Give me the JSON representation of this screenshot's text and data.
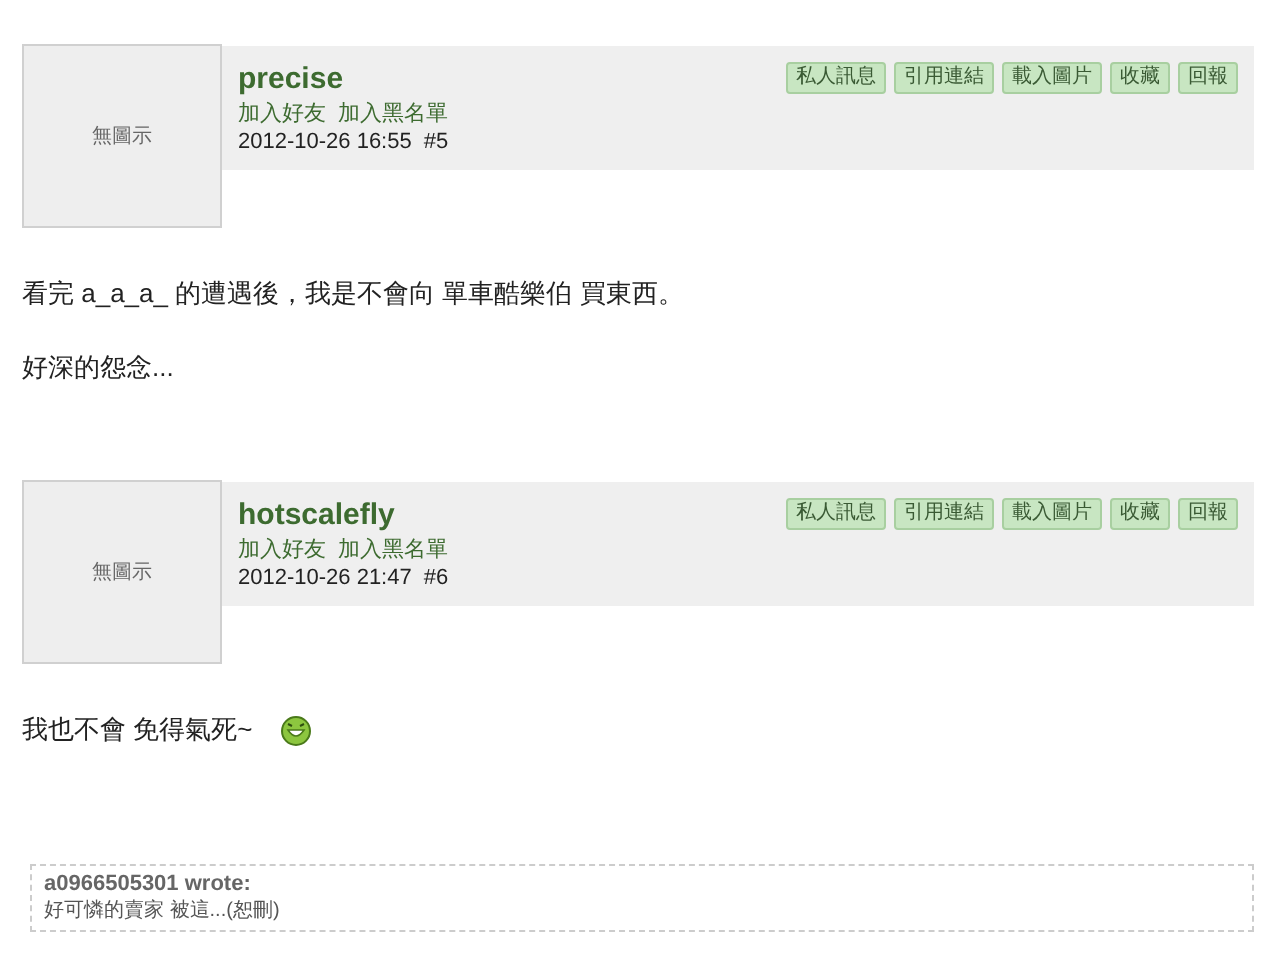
{
  "posts": [
    {
      "avatar": {
        "label": "無圖示"
      },
      "author": "precise",
      "links": [
        "加入好友",
        "加入黑名單"
      ],
      "timestamp": "2012-10-26 16:55",
      "post_number": "#5",
      "actions": [
        "私人訊息",
        "引用連結",
        "載入圖片",
        "收藏",
        "回報"
      ],
      "body": [
        {
          "text": "看完 a_a_a_ 的遭遇後，我是不會向 單車酷樂伯 買東西。",
          "emoticon": false
        },
        {
          "text": "好深的怨念...",
          "emoticon": false
        }
      ]
    },
    {
      "avatar": {
        "label": "無圖示"
      },
      "author": "hotscalefly",
      "links": [
        "加入好友",
        "加入黑名單"
      ],
      "timestamp": "2012-10-26 21:47",
      "post_number": "#6",
      "actions": [
        "私人訊息",
        "引用連結",
        "載入圖片",
        "收藏",
        "回報"
      ],
      "body": [
        {
          "text": "我也不會 免得氣死~",
          "emoticon": true
        }
      ],
      "quote": {
        "author_line": "a0966505301 wrote:",
        "text": "好可憐的賣家 被這...(恕刪)"
      }
    }
  ]
}
